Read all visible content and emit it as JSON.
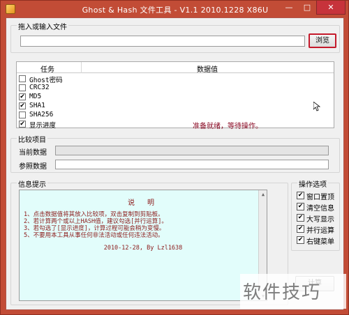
{
  "window": {
    "title": "Ghost & Hash 文件工具 - V1.1 2010.1228 X86U",
    "minimize": "—",
    "maximize": "□",
    "close": "✕"
  },
  "file_group": {
    "label": "拖入或输入文件",
    "path_value": "",
    "browse_label": "浏览"
  },
  "table": {
    "col_task": "任务",
    "col_value": "数据值",
    "rows": [
      {
        "label": "Ghost密码",
        "checked": false,
        "value": ""
      },
      {
        "label": "CRC32",
        "checked": false,
        "value": ""
      },
      {
        "label": "MD5",
        "checked": true,
        "value": ""
      },
      {
        "label": "SHA1",
        "checked": true,
        "value": ""
      },
      {
        "label": "SHA256",
        "checked": false,
        "value": ""
      },
      {
        "label": "显示进度",
        "checked": true,
        "value": "准备就绪，等待操作。"
      }
    ]
  },
  "compare_group": {
    "label": "比较项目",
    "current_label": "当前数据",
    "current_value": "",
    "reference_label": "参照数据",
    "reference_value": ""
  },
  "info_group": {
    "label": "信息提示",
    "title": "说 明",
    "lines": [
      "1、点击数据值将其放入比较项，双击复制到剪贴板。",
      "2、若计算两个或以上HASH值，建议勾选[并行运算]。",
      "3、若勾选了[显示进度]，计算过程可能会稍为变慢。",
      "5、不要用本工具从事任何非法活动或任何违法活动。"
    ],
    "footer": "2010-12-28, By Lzl1638"
  },
  "options_group": {
    "label": "操作选项",
    "items": [
      {
        "label": "窗口置顶",
        "checked": true
      },
      {
        "label": "清空信息",
        "checked": true
      },
      {
        "label": "大写显示",
        "checked": true
      },
      {
        "label": "并行运算",
        "checked": true
      },
      {
        "label": "右键菜单",
        "checked": true
      }
    ],
    "calc_label": "计算"
  },
  "watermark": {
    "text": "软件技巧"
  },
  "icons": {
    "check": "✔",
    "scroll_up": "▲",
    "scroll_down": "▼"
  },
  "colors": {
    "titlebar": "#c24c36",
    "info_bg": "#e2fdfb",
    "info_text": "#8c1a1a",
    "highlight_border": "#c4192b"
  }
}
